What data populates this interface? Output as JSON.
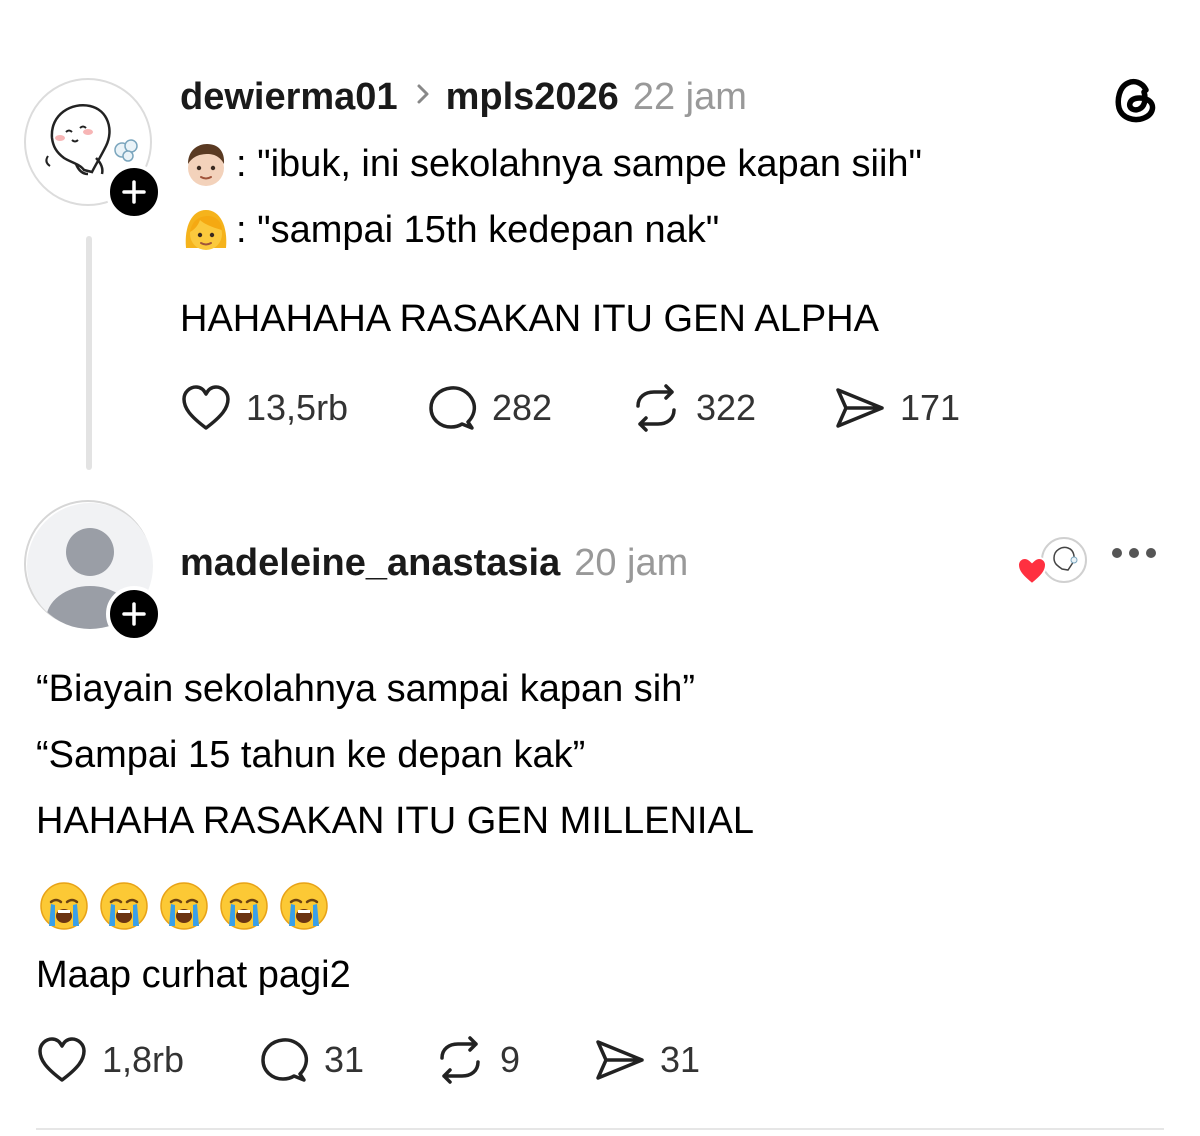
{
  "post1": {
    "username": "dewierma01",
    "community": "mpls2026",
    "time": "22 jam",
    "line1_text": ": \"ibuk, ini sekolahnya sampe kapan siih\"",
    "line2_text": ": \"sampai 15th kedepan nak\"",
    "line3_text": "HAHAHAHA RASAKAN ITU GEN ALPHA",
    "line1_emoji": "boy-emoji",
    "line2_emoji": "woman-emoji",
    "likes": "13,5rb",
    "comments": "282",
    "reposts": "322",
    "shares": "171"
  },
  "post2": {
    "username": "madeleine_anastasia",
    "time": "20 jam",
    "line1": "“Biayain sekolahnya sampai kapan sih”",
    "line2": "“Sampai 15 tahun ke depan kak”",
    "line3": "HAHAHA RASAKAN ITU GEN MILLENIAL",
    "emoji_count": 5,
    "emoji_name": "loudly-crying-face-emoji",
    "line4": "Maap curhat pagi2",
    "likes": "1,8rb",
    "comments": "31",
    "reposts": "9",
    "shares": "31"
  },
  "colors": {
    "text": "#000000",
    "muted": "#999999",
    "badge": "#000000",
    "heart_red": "#ff3040",
    "thread_line": "#e3e3e3"
  },
  "icons": {
    "brand": "threads-logo-icon",
    "like": "heart-icon",
    "comment": "comment-bubble-icon",
    "repost": "repost-icon",
    "share": "send-icon",
    "more": "more-dots-icon",
    "follow": "plus-icon"
  }
}
